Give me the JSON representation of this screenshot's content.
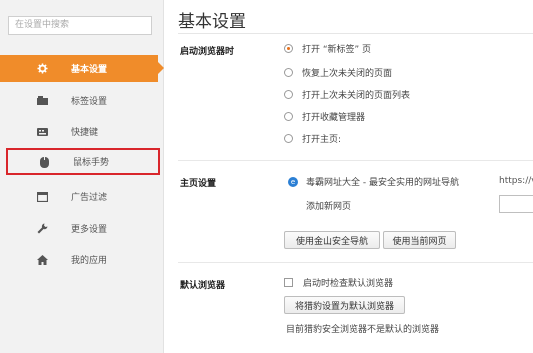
{
  "sidebar": {
    "search_placeholder": "在设置中搜索",
    "items": [
      {
        "label": "基本设置",
        "icon": "gear-icon"
      },
      {
        "label": "标签设置",
        "icon": "tab-icon"
      },
      {
        "label": "快捷键",
        "icon": "keyboard-icon"
      },
      {
        "label": "鼠标手势",
        "icon": "mouse-icon"
      },
      {
        "label": "广告过滤",
        "icon": "window-icon"
      },
      {
        "label": "更多设置",
        "icon": "wrench-icon"
      },
      {
        "label": "我的应用",
        "icon": "home-icon"
      }
    ]
  },
  "main": {
    "title": "基本设置",
    "startup": {
      "label": "启动浏览器时",
      "options": [
        {
          "label": "打开 “新标签” 页",
          "checked": true
        },
        {
          "label": "恢复上次未关闭的页面",
          "checked": false
        },
        {
          "label": "打开上次未关闭的页面列表",
          "checked": false
        },
        {
          "label": "打开收藏管理器",
          "checked": false
        },
        {
          "label": "打开主页:",
          "checked": false
        }
      ]
    },
    "homepage": {
      "label": "主页设置",
      "current_page": "毒霸网址大全 - 最安全实用的网址导航",
      "url": "https://v",
      "add_link": "添加新网页",
      "btn_safe_nav": "使用金山安全导航",
      "btn_current": "使用当前网页"
    },
    "default_browser": {
      "label": "默认浏览器",
      "checkbox_label": "启动时检查默认浏览器",
      "set_default_button": "将猎豹设置为默认浏览器",
      "status": "目前猎豹安全浏览器不是默认的浏览器"
    }
  },
  "colors": {
    "accent": "#f08c2a",
    "highlight_border": "#d9262b"
  }
}
